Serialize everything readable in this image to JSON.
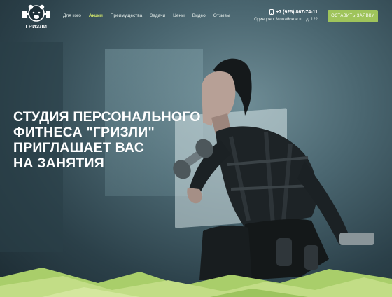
{
  "header": {
    "logo_text": "ГРИЗЛИ",
    "nav": [
      {
        "label": "Для кого",
        "active": false
      },
      {
        "label": "Акции",
        "active": true
      },
      {
        "label": "Преимущества",
        "active": false
      },
      {
        "label": "Задачи",
        "active": false
      },
      {
        "label": "Цены",
        "active": false
      },
      {
        "label": "Видео",
        "active": false
      },
      {
        "label": "Отзывы",
        "active": false
      }
    ],
    "phone": "+7 (925) 867-74-11",
    "phone_icon": "phone-icon",
    "address": "Одинцово, Можайское ш., д. 122",
    "cta_label": "ОСТАВИТЬ ЗАЯВКУ"
  },
  "hero": {
    "headline_lines": [
      "СТУДИЯ ПЕРСОНАЛЬНОГО",
      "ФИТНЕСА \"ГРИЗЛИ\"",
      "ПРИГЛАШАЕТ ВАС",
      "НА ЗАНЯТИЯ"
    ]
  },
  "colors": {
    "accent": "#9fc45b",
    "active_nav": "#cfe36b",
    "bottom_green": "#b3d372"
  }
}
